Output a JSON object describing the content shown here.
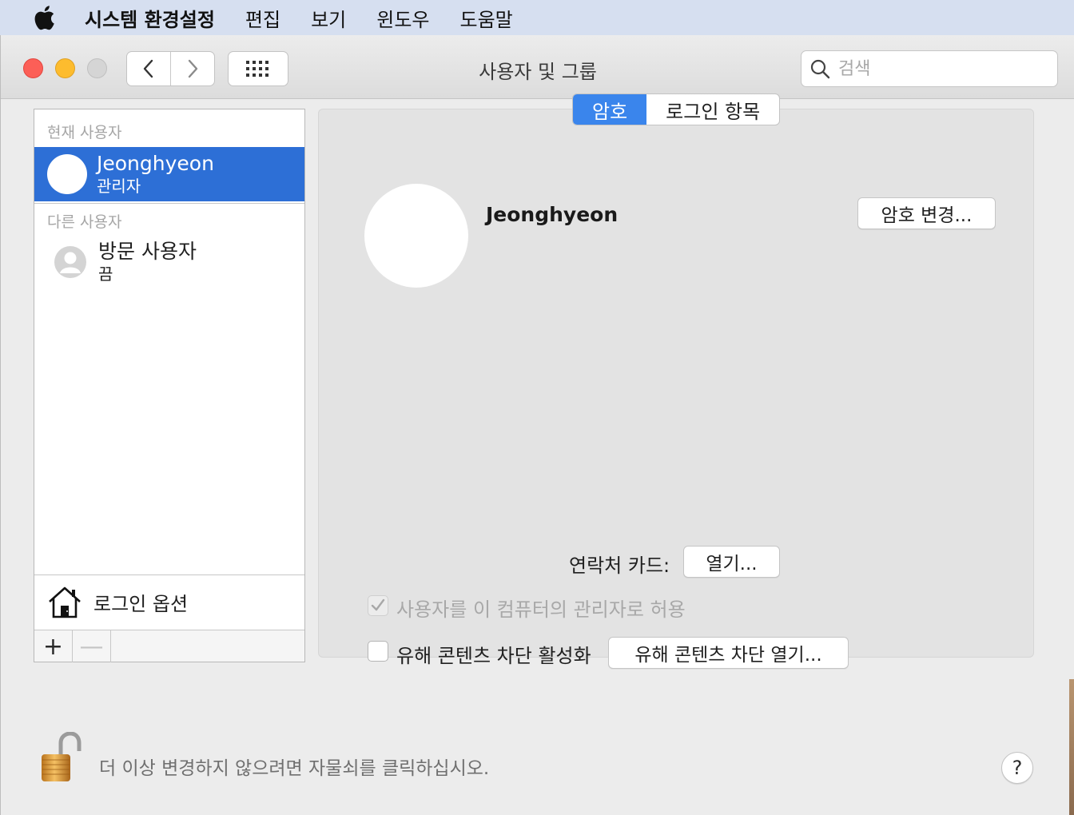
{
  "menubar": {
    "app_name": "시스템 환경설정",
    "items": [
      "편집",
      "보기",
      "윈도우",
      "도움말"
    ]
  },
  "window": {
    "title": "사용자 및 그룹",
    "search_placeholder": "검색"
  },
  "sidebar": {
    "current_users_header": "현재 사용자",
    "current_user": {
      "name": "Jeonghyeon",
      "role": "관리자"
    },
    "other_users_header": "다른 사용자",
    "other_users": [
      {
        "name": "방문 사용자",
        "status": "끔"
      }
    ],
    "login_options_label": "로그인 옵션",
    "add_label": "+",
    "remove_label": "—"
  },
  "tabs": [
    {
      "label": "암호",
      "active": true
    },
    {
      "label": "로그인 항목",
      "active": false
    }
  ],
  "detail": {
    "user_name": "Jeonghyeon",
    "change_password_label": "암호 변경...",
    "contact_card_label": "연락처 카드:",
    "open_button_label": "열기...",
    "allow_admin_label": "사용자를 이 컴퓨터의 관리자로 허용",
    "allow_admin_checked": true,
    "parental_label": "유해 콘텐츠 차단 활성화",
    "parental_checked": false,
    "parental_open_label": "유해 콘텐츠 차단 열기..."
  },
  "footer": {
    "lock_text": "더 이상 변경하지 않으려면 자물쇠를 클릭하십시오.",
    "help_label": "?"
  },
  "colors": {
    "selection": "#2d6fd6",
    "tab_active": "#3a85ec",
    "close": "#fc5f57",
    "minimize": "#fdbc2e"
  }
}
